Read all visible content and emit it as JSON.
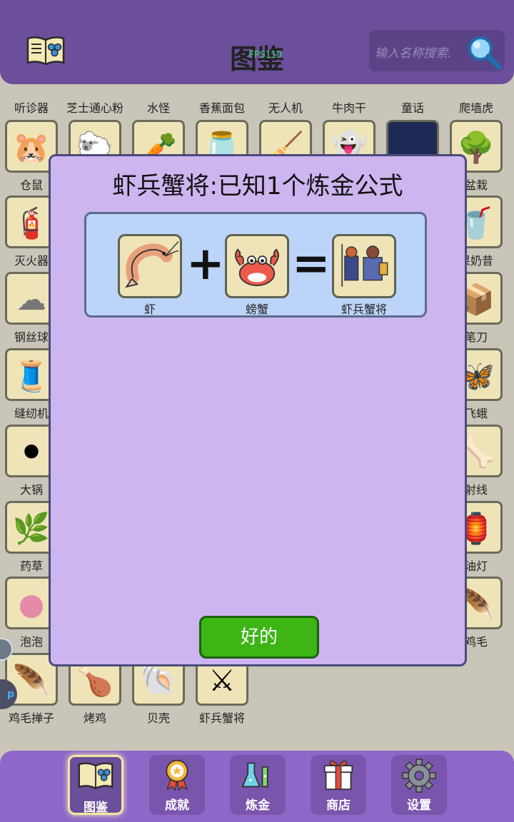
{
  "header": {
    "title": "图鉴",
    "fps": "FPS119",
    "search_placeholder": "输入名称搜索."
  },
  "grid_items": [
    [
      "听诊器",
      "芝士通心粉",
      "水怪",
      "香蕉面包",
      "无人机",
      "牛肉干",
      "童话",
      "爬墙虎"
    ],
    [
      "仓鼠",
      "",
      "",
      "",
      "",
      "",
      "",
      "盆栽"
    ],
    [
      "灭火器",
      "",
      "",
      "",
      "",
      "",
      "",
      "果奶昔"
    ],
    [
      "钢丝球",
      "",
      "",
      "",
      "",
      "",
      "",
      "笔刀"
    ],
    [
      "缝纫机",
      "",
      "",
      "",
      "",
      "",
      "",
      "飞蛾"
    ],
    [
      "大锅",
      "",
      "",
      "",
      "",
      "",
      "",
      "射线"
    ],
    [
      "药草",
      "",
      "",
      "",
      "",
      "",
      "",
      "油灯"
    ],
    [
      "泡泡",
      "",
      "",
      "",
      "",
      "",
      "",
      "鸡毛"
    ],
    [
      "鸡毛掸子",
      "烤鸡",
      "贝壳",
      "虾兵蟹将"
    ]
  ],
  "modal": {
    "title": "虾兵蟹将:已知1个炼金公式",
    "recipe": {
      "input_a": "虾",
      "input_b": "螃蟹",
      "result": "虾兵蟹将",
      "plus": "+",
      "equals": "="
    },
    "ok_label": "好的"
  },
  "nav": [
    {
      "label": "图鉴",
      "icon": "book-icon",
      "active": true
    },
    {
      "label": "成就",
      "icon": "medal-icon",
      "active": false
    },
    {
      "label": "炼金",
      "icon": "flask-icon",
      "active": false
    },
    {
      "label": "商店",
      "icon": "gift-icon",
      "active": false
    },
    {
      "label": "设置",
      "icon": "gear-icon",
      "active": false
    }
  ],
  "colors": {
    "header": "#6b4f9a",
    "modal": "#cdb5f0",
    "ok_button": "#3cb515",
    "bottom_bar": "#8f67c8"
  }
}
